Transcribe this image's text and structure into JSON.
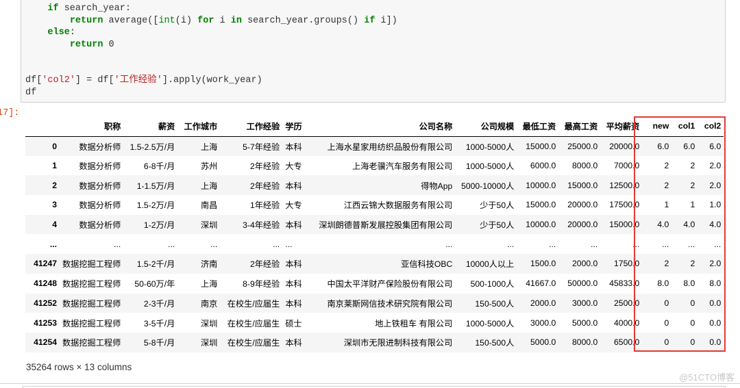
{
  "code_cell": {
    "lines": [
      {
        "indent": "    ",
        "parts": [
          {
            "t": "if",
            "c": "kw"
          },
          {
            "t": " search_year:",
            "c": ""
          }
        ]
      },
      {
        "indent": "        ",
        "parts": [
          {
            "t": "return",
            "c": "kw"
          },
          {
            "t": " average([",
            "c": ""
          },
          {
            "t": "int",
            "c": "bi"
          },
          {
            "t": "(i) ",
            "c": ""
          },
          {
            "t": "for",
            "c": "kw"
          },
          {
            "t": " i ",
            "c": ""
          },
          {
            "t": "in",
            "c": "kw"
          },
          {
            "t": " search_year.groups() ",
            "c": ""
          },
          {
            "t": "if",
            "c": "kw"
          },
          {
            "t": " i])",
            "c": ""
          }
        ]
      },
      {
        "indent": "    ",
        "parts": [
          {
            "t": "else",
            "c": "kw"
          },
          {
            "t": ":",
            "c": ""
          }
        ]
      },
      {
        "indent": "        ",
        "parts": [
          {
            "t": "return",
            "c": "kw"
          },
          {
            "t": " 0",
            "c": "num"
          }
        ]
      },
      {
        "indent": "",
        "parts": []
      },
      {
        "indent": "",
        "parts": []
      },
      {
        "indent": "",
        "parts": [
          {
            "t": "df[",
            "c": ""
          },
          {
            "t": "'col2'",
            "c": "str"
          },
          {
            "t": "] = df[",
            "c": ""
          },
          {
            "t": "'工作经验'",
            "c": "str"
          },
          {
            "t": "].apply(work_year)",
            "c": ""
          }
        ]
      },
      {
        "indent": "",
        "parts": [
          {
            "t": "df",
            "c": ""
          }
        ]
      }
    ]
  },
  "output_prompt": "17]:",
  "table": {
    "columns": [
      "职称",
      "薪资",
      "工作城市",
      "工作经验",
      "学历",
      "公司名称",
      "公司规模",
      "最低工资",
      "最高工资",
      "平均薪资",
      "new",
      "col1",
      "col2"
    ],
    "rows": [
      {
        "index": "0",
        "cells": [
          "数据分析师",
          "1.5-2.5万/月",
          "上海",
          "5-7年经验",
          "本科",
          "上海水星家用纺织品股份有限公司",
          "1000-5000人",
          "15000.0",
          "25000.0",
          "20000.0",
          "6.0",
          "6.0",
          "6.0"
        ]
      },
      {
        "index": "1",
        "cells": [
          "数据分析师",
          "6-8千/月",
          "苏州",
          "2年经验",
          "大专",
          "上海老骥汽车服务有限公司",
          "1000-5000人",
          "6000.0",
          "8000.0",
          "7000.0",
          "2",
          "2",
          "2.0"
        ]
      },
      {
        "index": "2",
        "cells": [
          "数据分析师",
          "1-1.5万/月",
          "上海",
          "2年经验",
          "本科",
          "得物App",
          "5000-10000人",
          "10000.0",
          "15000.0",
          "12500.0",
          "2",
          "2",
          "2.0"
        ]
      },
      {
        "index": "3",
        "cells": [
          "数据分析师",
          "1.5-2万/月",
          "南昌",
          "1年经验",
          "大专",
          "江西云锦大数据服务有限公司",
          "少于50人",
          "15000.0",
          "20000.0",
          "17500.0",
          "1",
          "1",
          "1.0"
        ]
      },
      {
        "index": "4",
        "cells": [
          "数据分析师",
          "1-2万/月",
          "深圳",
          "3-4年经验",
          "本科",
          "深圳朗德普斯发展控股集团有限公司",
          "少于50人",
          "10000.0",
          "20000.0",
          "15000.0",
          "4.0",
          "4.0",
          "4.0"
        ]
      },
      {
        "index": "...",
        "cells": [
          "...",
          "...",
          "...",
          "...",
          "...",
          "...",
          "...",
          "...",
          "...",
          "...",
          "...",
          "...",
          "..."
        ]
      },
      {
        "index": "41247",
        "cells": [
          "数据挖掘工程师",
          "1.5-2千/月",
          "济南",
          "2年经验",
          "本科",
          "亚信科技OBC",
          "10000人以上",
          "1500.0",
          "2000.0",
          "1750.0",
          "2",
          "2",
          "2.0"
        ]
      },
      {
        "index": "41248",
        "cells": [
          "数据挖掘工程师",
          "50-60万/年",
          "上海",
          "8-9年经验",
          "本科",
          "中国太平洋财产保险股份有限公司",
          "500-1000人",
          "41667.0",
          "50000.0",
          "45833.0",
          "8.0",
          "8.0",
          "8.0"
        ]
      },
      {
        "index": "41252",
        "cells": [
          "数据挖掘工程师",
          "2-3千/月",
          "南京",
          "在校生/应届生",
          "本科",
          "南京莱斯网信技术研究院有限公司",
          "150-500人",
          "2000.0",
          "3000.0",
          "2500.0",
          "0",
          "0",
          "0.0"
        ]
      },
      {
        "index": "41253",
        "cells": [
          "数据挖掘工程师",
          "3-5千/月",
          "深圳",
          "在校生/应届生",
          "硕士",
          "地上铁租车 有限公司",
          "1000-5000人",
          "3000.0",
          "5000.0",
          "4000.0",
          "0",
          "0",
          "0.0"
        ]
      },
      {
        "index": "41254",
        "cells": [
          "数据挖掘工程师",
          "5-8千/月",
          "深圳",
          "在校生/应届生",
          "本科",
          "深圳市无限进制科技有限公司",
          "150-500人",
          "5000.0",
          "8000.0",
          "6500.0",
          "0",
          "0",
          "0.0"
        ]
      }
    ]
  },
  "shape_info": "35264 rows × 13 columns",
  "watermark": "@51CTO博客",
  "colors": {
    "highlight_box": "#e53935",
    "output_prompt": "#d84315",
    "keyword": "#008000",
    "string": "#ba2121"
  }
}
